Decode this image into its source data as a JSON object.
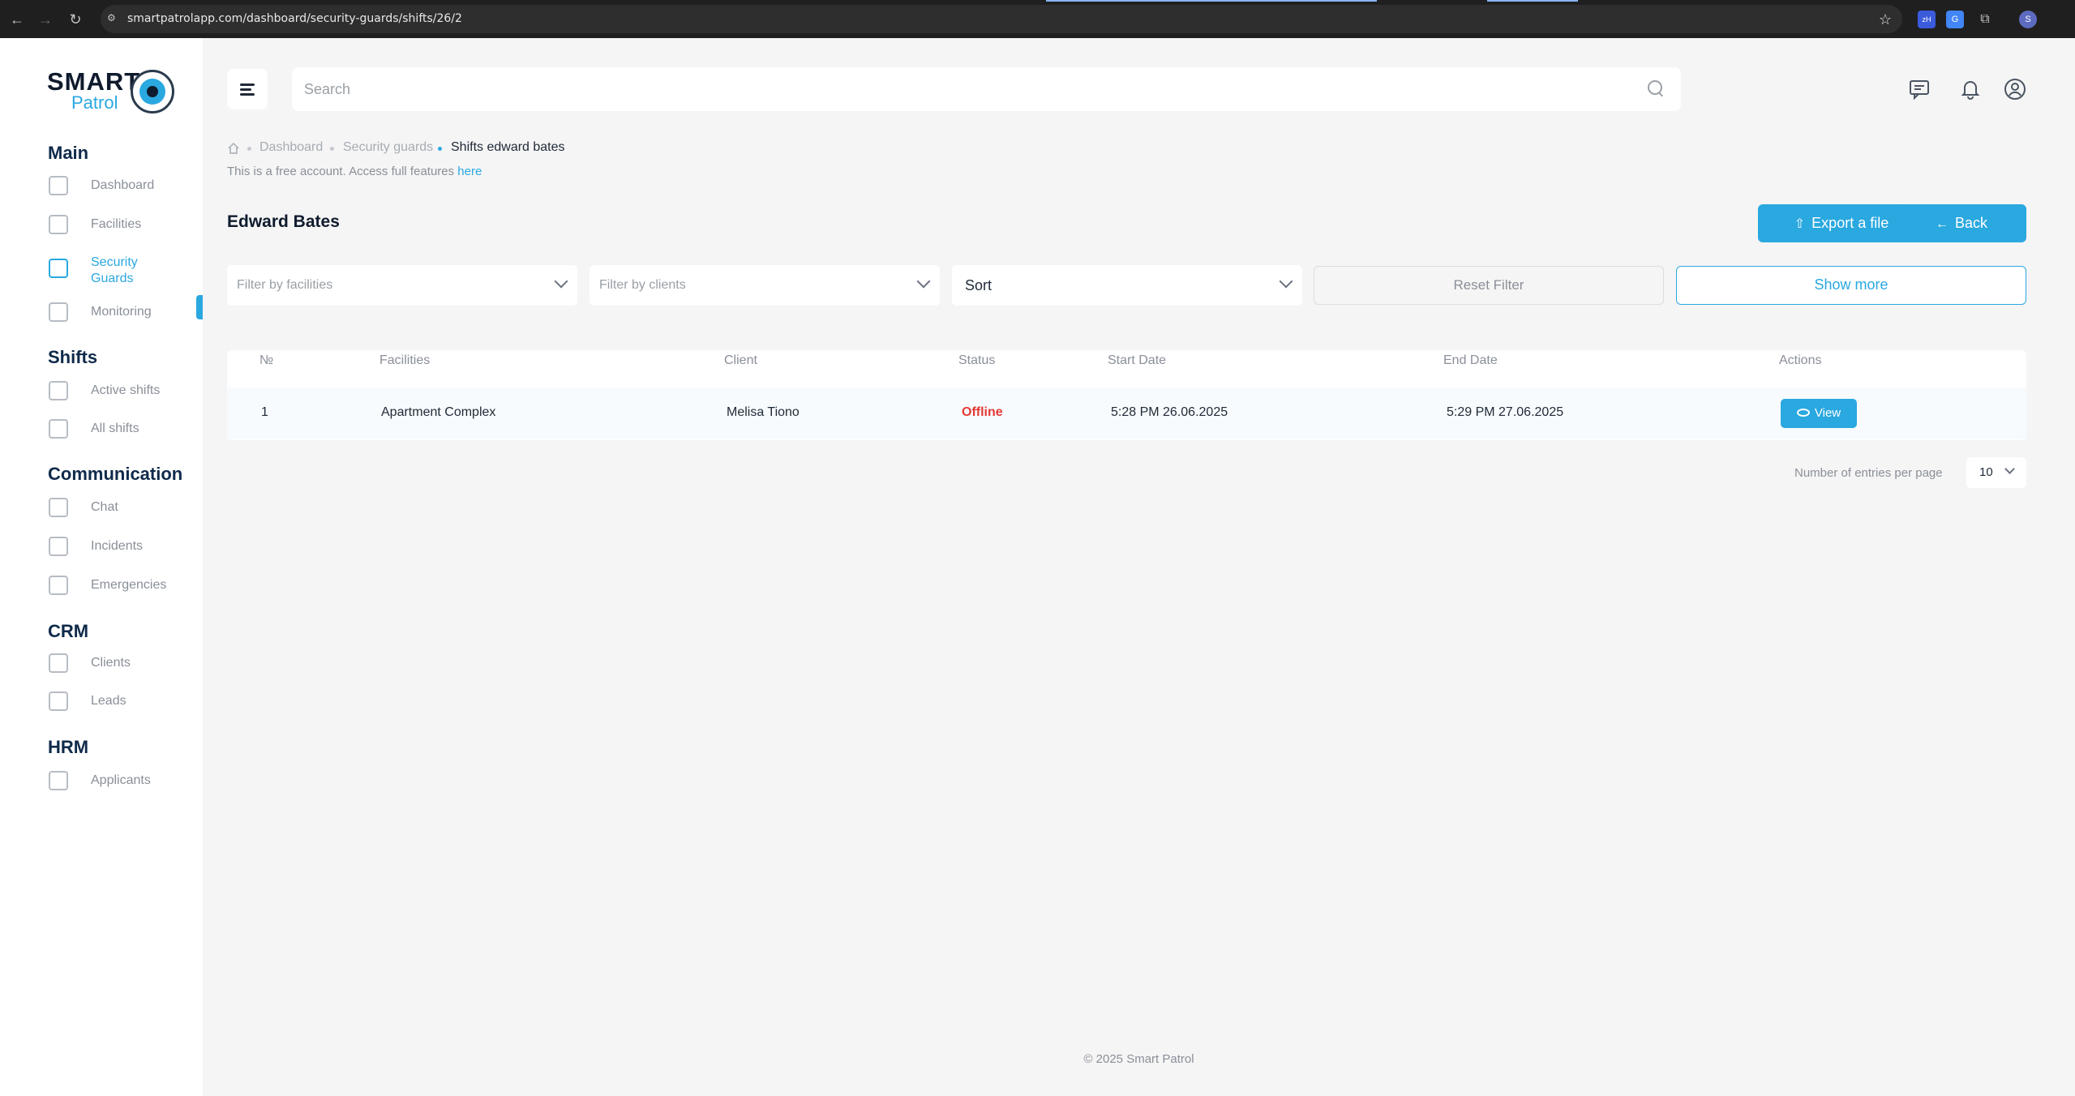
{
  "browser": {
    "url": "smartpatrolapp.com/dashboard/security-guards/shifts/26/2",
    "profile_initial": "S"
  },
  "logo": {
    "smart": "SMART",
    "patrol": "Patrol"
  },
  "sidebar": {
    "sections": [
      {
        "title": "Main",
        "items": [
          {
            "label": "Dashboard",
            "icon": "grid-icon"
          },
          {
            "label": "Facilities",
            "icon": "building-icon"
          },
          {
            "label": "Security Guards",
            "icon": "guard-icon",
            "active": true
          },
          {
            "label": "Monitoring",
            "icon": "monitor-icon"
          }
        ]
      },
      {
        "title": "Shifts",
        "items": [
          {
            "label": "Active shifts",
            "icon": "clock-icon"
          },
          {
            "label": "All shifts",
            "icon": "calendar-icon"
          }
        ]
      },
      {
        "title": "Communication",
        "items": [
          {
            "label": "Chat",
            "icon": "chat-icon"
          },
          {
            "label": "Incidents",
            "icon": "incident-icon"
          },
          {
            "label": "Emergencies",
            "icon": "alarm-icon"
          }
        ]
      },
      {
        "title": "CRM",
        "items": [
          {
            "label": "Clients",
            "icon": "clients-icon"
          },
          {
            "label": "Leads",
            "icon": "leads-icon"
          }
        ]
      },
      {
        "title": "HRM",
        "items": [
          {
            "label": "Applicants",
            "icon": "applicants-icon"
          }
        ]
      }
    ]
  },
  "header": {
    "search_placeholder": "Search"
  },
  "breadcrumb": {
    "items": [
      "Dashboard",
      "Security guards"
    ],
    "current": "Shifts edward bates"
  },
  "notice": {
    "text": "This is a free account. Access full features ",
    "link": "here"
  },
  "page": {
    "title": "Edward Bates",
    "export_label": "Export a file",
    "back_label": "Back"
  },
  "filters": {
    "facilities_placeholder": "Filter by facilities",
    "clients_placeholder": "Filter by clients",
    "sort_value": "Sort",
    "reset_label": "Reset Filter",
    "show_more_label": "Show more"
  },
  "table": {
    "columns": [
      "№",
      "Facilities",
      "Client",
      "Status",
      "Start Date",
      "End Date",
      "Actions"
    ],
    "rows": [
      {
        "num": "1",
        "facility": "Apartment Complex",
        "client": "Melisa Tiono",
        "status": "Offline",
        "start": "5:28 PM 26.06.2025",
        "end": "5:29 PM 27.06.2025",
        "action": "View"
      }
    ]
  },
  "pagination": {
    "label": "Number of entries per page",
    "value": "10"
  },
  "footer": {
    "text": "© 2025 Smart Patrol"
  },
  "colors": {
    "accent": "#2aa8e0",
    "status_offline": "#e53935"
  }
}
